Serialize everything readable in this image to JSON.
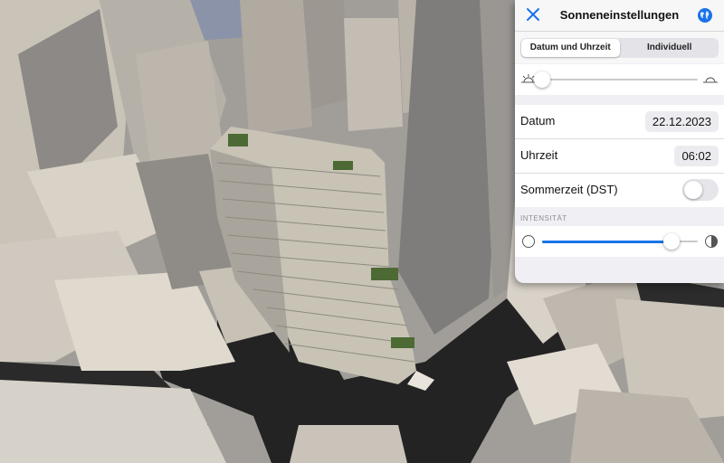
{
  "panel": {
    "title": "Sonneneinstellungen",
    "tabs": [
      {
        "label": "Datum und Uhrzeit",
        "active": true
      },
      {
        "label": "Individuell",
        "active": false
      }
    ],
    "sun_position_fraction": 0.0,
    "date": {
      "label": "Datum",
      "value": "22.12.2023"
    },
    "time": {
      "label": "Uhrzeit",
      "value": "06:02"
    },
    "dst": {
      "label": "Sommerzeit (DST)",
      "enabled": false
    },
    "intensity": {
      "section_label": "INTENSITÄT",
      "fraction": 0.83
    },
    "colors": {
      "accent": "#1a73e8",
      "panel_bg": "#efeff4"
    },
    "icons": [
      "close-icon",
      "globe-icon",
      "sunrise-icon",
      "sunset-icon",
      "circle-empty-icon",
      "contrast-icon"
    ]
  }
}
